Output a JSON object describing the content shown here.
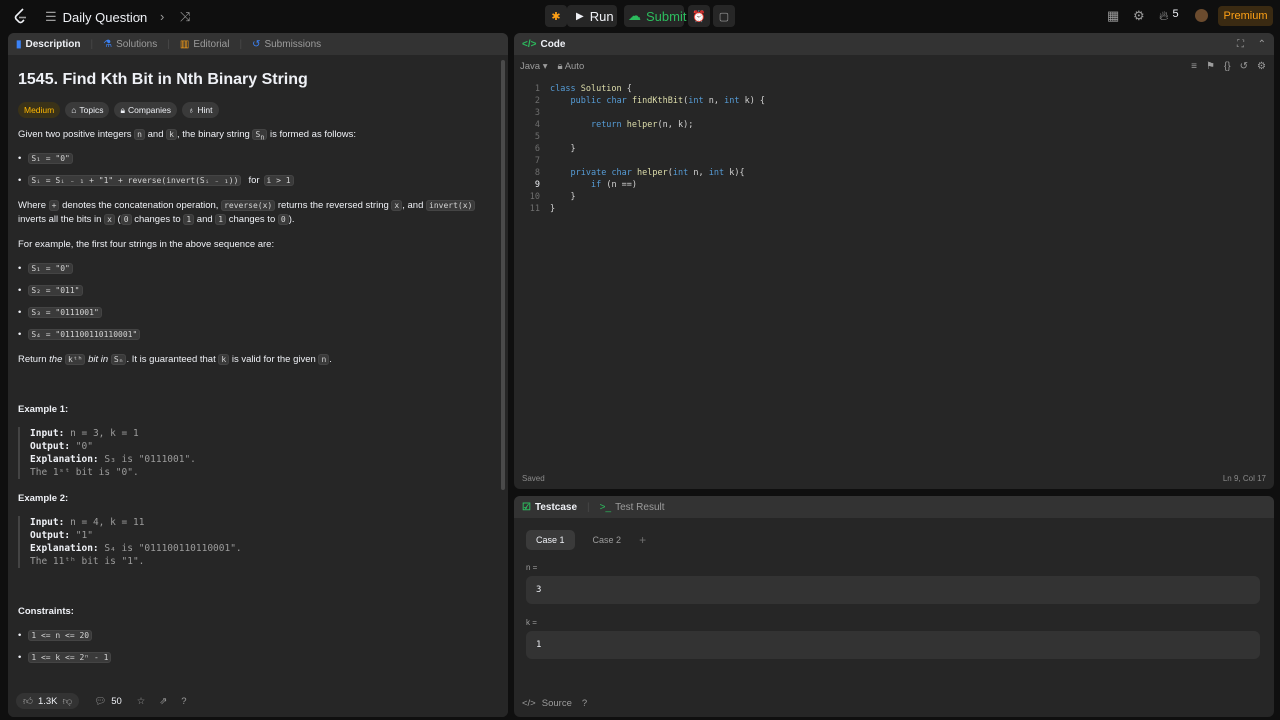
{
  "topbar": {
    "daily_label": "Daily Question",
    "run_label": "Run",
    "submit_label": "Submit",
    "streak_count": "5",
    "premium_label": "Premium"
  },
  "left": {
    "tabs": [
      "Description",
      "Solutions",
      "Editorial",
      "Submissions"
    ],
    "title": "1545. Find Kth Bit in Nth Binary String",
    "tags": {
      "difficulty": "Medium",
      "topics": "Topics",
      "companies": "Companies",
      "hint": "Hint"
    },
    "intro": {
      "a": "Given two positive integers",
      "n": "n",
      "and": "and",
      "k": "k",
      "b": ", the binary string",
      "sn": "S",
      "sn_sub": "n",
      "c": "is formed as follows:"
    },
    "rule1": "S₁ = \"0\"",
    "rule2": "Sᵢ = Sᵢ ₋ ₁ + \"1\" + reverse(invert(Sᵢ ₋ ₁))",
    "rule2_for": "for",
    "rule2_cond": "i > 1",
    "where1": {
      "a": "Where",
      "plus": "+",
      "b": "denotes the concatenation operation,",
      "rev": "reverse(x)",
      "c": "returns the reversed string",
      "x": "x",
      "d": ", and",
      "inv": "invert(x)"
    },
    "where2": {
      "a": "inverts all the bits in",
      "x": "x",
      "b": "(",
      "zero": "0",
      "c": "changes to",
      "one": "1",
      "d": "and",
      "one2": "1",
      "e": "changes to",
      "zero2": "0",
      "f": ")."
    },
    "example_intro": "For example, the first four strings in the above sequence are:",
    "seq": [
      "S₁ = \"0\"",
      "S₂ = \"011\"",
      "S₃ = \"0111001\"",
      "S₄ = \"011100110110001\""
    ],
    "return": {
      "a": "Return",
      "b": "the",
      "kth": "kᵗʰ",
      "c": "bit in",
      "sn": "Sₙ",
      "d": ". It is guaranteed that",
      "k": "k",
      "e": "is valid for the given",
      "n": "n",
      "f": "."
    },
    "ex1_title": "Example 1:",
    "ex1": {
      "input_label": "Input:",
      "input": "n = 3, k = 1",
      "output_label": "Output:",
      "output": "\"0\"",
      "expl_label": "Explanation:",
      "expl": "S₃ is \"0111001\".",
      "expl2": "The 1ˢᵗ bit is \"0\"."
    },
    "ex2_title": "Example 2:",
    "ex2": {
      "input_label": "Input:",
      "input": "n = 4, k = 11",
      "output_label": "Output:",
      "output": "\"1\"",
      "expl_label": "Explanation:",
      "expl": "S₄ is \"011100110110001\".",
      "expl2": "The 11ᵗʰ bit is \"1\"."
    },
    "constraints_title": "Constraints:",
    "constraints": [
      "1 <= n <= 20",
      "1 <= k <= 2ⁿ - 1"
    ],
    "footer": {
      "likes": "1.3K",
      "comments": "50"
    }
  },
  "code": {
    "header": "Code",
    "language": "Java",
    "mode": "Auto",
    "saved": "Saved",
    "position": "Ln 9, Col 17"
  },
  "test": {
    "tabs": [
      "Testcase",
      "Test Result"
    ],
    "cases": [
      "Case 1",
      "Case 2"
    ],
    "var_n": "n =",
    "val_n": "3",
    "var_k": "k =",
    "val_k": "1",
    "source": "Source"
  }
}
